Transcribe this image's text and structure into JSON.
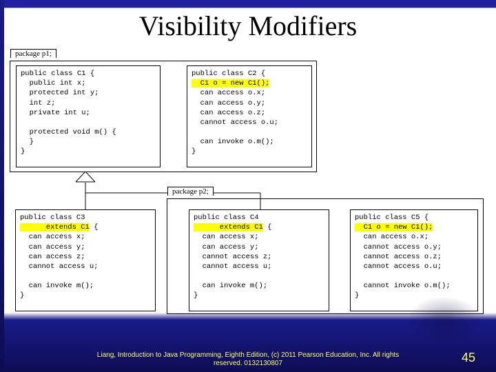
{
  "title": "Visibility Modifiers",
  "pkg1": {
    "label": "package p1;",
    "c1": {
      "l1": "public class C1 {",
      "l2": "  public int x;",
      "l3": "  protected int y;",
      "l4": "  int z;",
      "l5": "  private int u;",
      "l6": "",
      "l7": "  protected void m() {",
      "l8": "  }",
      "l9": "}"
    },
    "c2": {
      "l1": "public class C2 {",
      "h2": "  C1 o = new C1();",
      "l3": "  can access o.x;",
      "l4": "  can access o.y;",
      "l5": "  can access o.z;",
      "l6": "  cannot access o.u;",
      "l7": "",
      "l8": "  can invoke o.m();",
      "l9": "}"
    }
  },
  "pkg2": {
    "label": "package p2;",
    "c3": {
      "l1": "public class C3",
      "h2": "      extends C1",
      "h2s": " {",
      "l3": "  can access x;",
      "l4": "  can access y;",
      "l5": "  can access z;",
      "l6": "  cannot access u;",
      "l7": "",
      "l8": "  can invoke m();",
      "l9": "}"
    },
    "c4": {
      "l1": "public class C4",
      "h2": "      extends C1",
      "h2s": " {",
      "l3": "  can access x;",
      "l4": "  can access y;",
      "l5": "  cannot access z;",
      "l6": "  cannot access u;",
      "l7": "",
      "l8": "  can invoke m();",
      "l9": "}"
    },
    "c5": {
      "l1": "public class C5 {",
      "h2": "  C1 o = new C1();",
      "l3": "  can access o.x;",
      "l4": "  cannot access o.y;",
      "l5": "  cannot access o.z;",
      "l6": "  cannot access o.u;",
      "l7": "",
      "l8": "  cannot invoke o.m();",
      "l9": "}"
    }
  },
  "footer": "Liang, Introduction to Java Programming, Eighth Edition, (c) 2011 Pearson Education, Inc. All rights reserved. 0132130807",
  "page": "45"
}
